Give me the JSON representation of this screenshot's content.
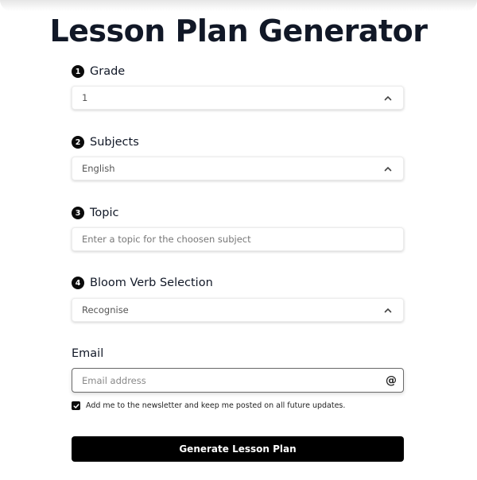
{
  "page": {
    "title": "Lesson Plan Generator"
  },
  "form": {
    "grade": {
      "step": "1",
      "label": "Grade",
      "selected": "1",
      "icon": "chevron-up-icon"
    },
    "subjects": {
      "step": "2",
      "label": "Subjects",
      "selected": "English",
      "icon": "chevron-up-icon"
    },
    "topic": {
      "step": "3",
      "label": "Topic",
      "value": "",
      "placeholder": "Enter a topic for the choosen subject"
    },
    "bloom_verb": {
      "step": "4",
      "label": "Bloom Verb Selection",
      "selected": "Recognise",
      "icon": "chevron-up-icon"
    },
    "email": {
      "label": "Email",
      "value": "",
      "placeholder": "Email address",
      "icon": "at-sign-icon",
      "icon_glyph": "@"
    },
    "newsletter": {
      "checked": true,
      "label": "Add me to the newsletter and keep me posted on all future updates."
    },
    "submit_label": "Generate Lesson Plan"
  },
  "colors": {
    "primary": "#000000",
    "title_text": "#111827",
    "badge": "#0b0b0b"
  }
}
